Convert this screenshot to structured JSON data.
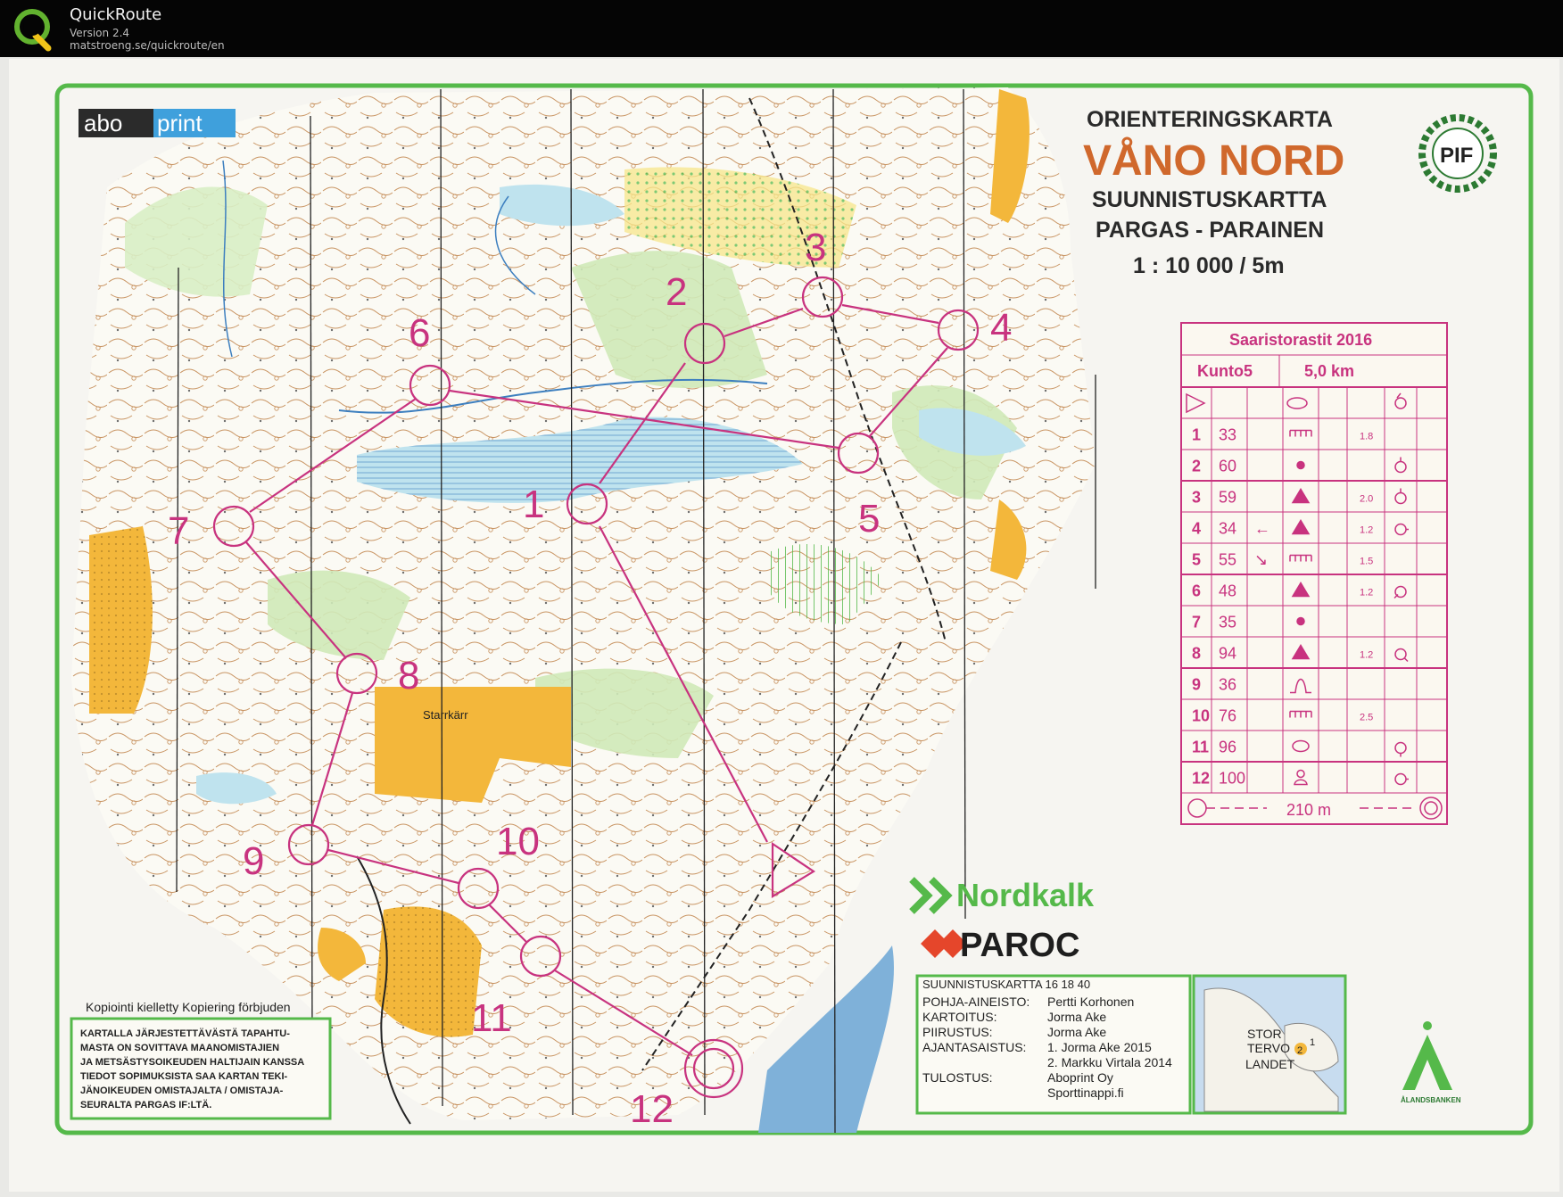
{
  "app": {
    "name": "QuickRoute",
    "version": "Version 2.4",
    "url": "matstroeng.se/quickroute/en",
    "logo_icon": "quickroute-q-logo"
  },
  "map": {
    "printer_logo": {
      "left": "abo",
      "right": "print"
    },
    "title_sv": "ORIENTERINGSKARTA",
    "title_main": "VÅNO NORD",
    "title_fi": "SUUNNISTUSKARTTA",
    "place": "PARGAS - PARAINEN",
    "scale": "1 : 10 000 / 5m",
    "club_logo": "PIF",
    "area_name": "Starrkärr",
    "copy_notice": "Kopiointi kielletty  Kopiering förbjuden",
    "legal_lines": [
      "KARTALLA JÄRJESTETTÄVÄSTÄ TAPAHTU-",
      "MASTA ON SOVITTAVA MAANOMISTAJIEN",
      "JA METSÄSTYSOIKEUDEN HALTIJAIN KANSSA",
      "TIEDOT SOPIMUKSISTA SAA KARTAN TEKI-",
      "JÄNOIKEUDEN OMISTAJALTA / OMISTAJA-",
      "SEURALTA PARGAS IF:LTÄ."
    ],
    "sponsors": {
      "nordkalk": "Nordkalk",
      "paroc": "PAROC"
    },
    "credits": {
      "header": "SUUNNISTUSKARTTA  16 18 40",
      "rows": [
        {
          "label": "POHJA-AINEISTO:",
          "value": "Pertti Korhonen"
        },
        {
          "label": "KARTOITUS:",
          "value": "Jorma Ake"
        },
        {
          "label": "PIIRUSTUS:",
          "value": "Jorma Ake"
        },
        {
          "label": "AJANTASAISTUS:",
          "value": "1. Jorma Ake 2015"
        },
        {
          "label": "",
          "value": "2. Markku Virtala 2014"
        },
        {
          "label": "TULOSTUS:",
          "value": "Aboprint Oy"
        },
        {
          "label": "",
          "value": "Sporttinappi.fi"
        }
      ]
    },
    "inset_labels": {
      "line1": "STOR",
      "line2": "TERVO",
      "line3": "LANDET",
      "num1": "1",
      "num2": "2"
    },
    "bank_name": "ÅLANDSBANKEN",
    "colors": {
      "purple": "#c8337f",
      "brown": "#b86a2a",
      "yellow": "#f3b73b",
      "green": "#55b94a",
      "blue": "#3d7fbf"
    }
  },
  "course": {
    "event": "Saaristorastit 2016",
    "class": "Kunto5",
    "length": "5,0 km",
    "finish_distance": "210 m",
    "controls": [
      {
        "num": "1",
        "code": "33",
        "symbol": "ditch",
        "dim": "1.8",
        "detail": ""
      },
      {
        "num": "2",
        "code": "60",
        "symbol": "dot",
        "dim": "",
        "detail": "ring-top"
      },
      {
        "num": "3",
        "code": "59",
        "symbol": "triangle",
        "dim": "2.0",
        "detail": "ring-top"
      },
      {
        "num": "4",
        "code": "34",
        "symbol": "triangle",
        "dim": "1.2",
        "detail": "ring-right",
        "dir": "←"
      },
      {
        "num": "5",
        "code": "55",
        "symbol": "ditch",
        "dim": "1.5",
        "detail": "",
        "dir": "↘"
      },
      {
        "num": "6",
        "code": "48",
        "symbol": "triangle",
        "dim": "1.2",
        "detail": "ring-upright"
      },
      {
        "num": "7",
        "code": "35",
        "symbol": "dot",
        "dim": "",
        "detail": ""
      },
      {
        "num": "8",
        "code": "94",
        "symbol": "triangle",
        "dim": "1.2",
        "detail": "ring-downright"
      },
      {
        "num": "9",
        "code": "36",
        "symbol": "knoll",
        "dim": "",
        "detail": ""
      },
      {
        "num": "10",
        "code": "76",
        "symbol": "ditch",
        "dim": "2.5",
        "detail": ""
      },
      {
        "num": "11",
        "code": "96",
        "symbol": "ellipse",
        "dim": "",
        "detail": "ring-bottom"
      },
      {
        "num": "12",
        "code": "100",
        "symbol": "person",
        "dim": "",
        "detail": "ring-right"
      }
    ],
    "map_labels": [
      "1",
      "2",
      "3",
      "4",
      "5",
      "6",
      "7",
      "8",
      "9",
      "10",
      "11",
      "12"
    ]
  }
}
